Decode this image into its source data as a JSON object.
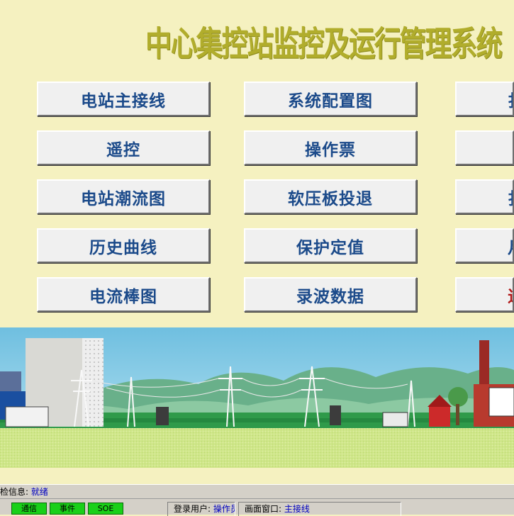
{
  "app": {
    "title": "中心集控站监控及运行管理系统"
  },
  "menu": {
    "col1": [
      "电站主接线",
      "遥控",
      "电站潮流图",
      "历史曲线",
      "电流棒图"
    ],
    "col2": [
      "系统配置图",
      "操作票",
      "软压板投退",
      "保护定值",
      "录波数据"
    ],
    "col3": [
      "扌",
      "",
      "扌",
      "月",
      "退"
    ]
  },
  "status": {
    "check_label": "检信息:",
    "check_value": "就绪",
    "indicators": [
      "通信",
      "事件",
      "SOE"
    ],
    "user_label": "登录用户:",
    "user_value": "操作员",
    "window_label": "画面窗口:",
    "window_value": "主接线"
  },
  "colors": {
    "background": "#f5f1c0",
    "title": "#b1ad2c",
    "button_text": "#1b4a8a",
    "button_text_alert": "#b01515",
    "indicator": "#19d019"
  }
}
